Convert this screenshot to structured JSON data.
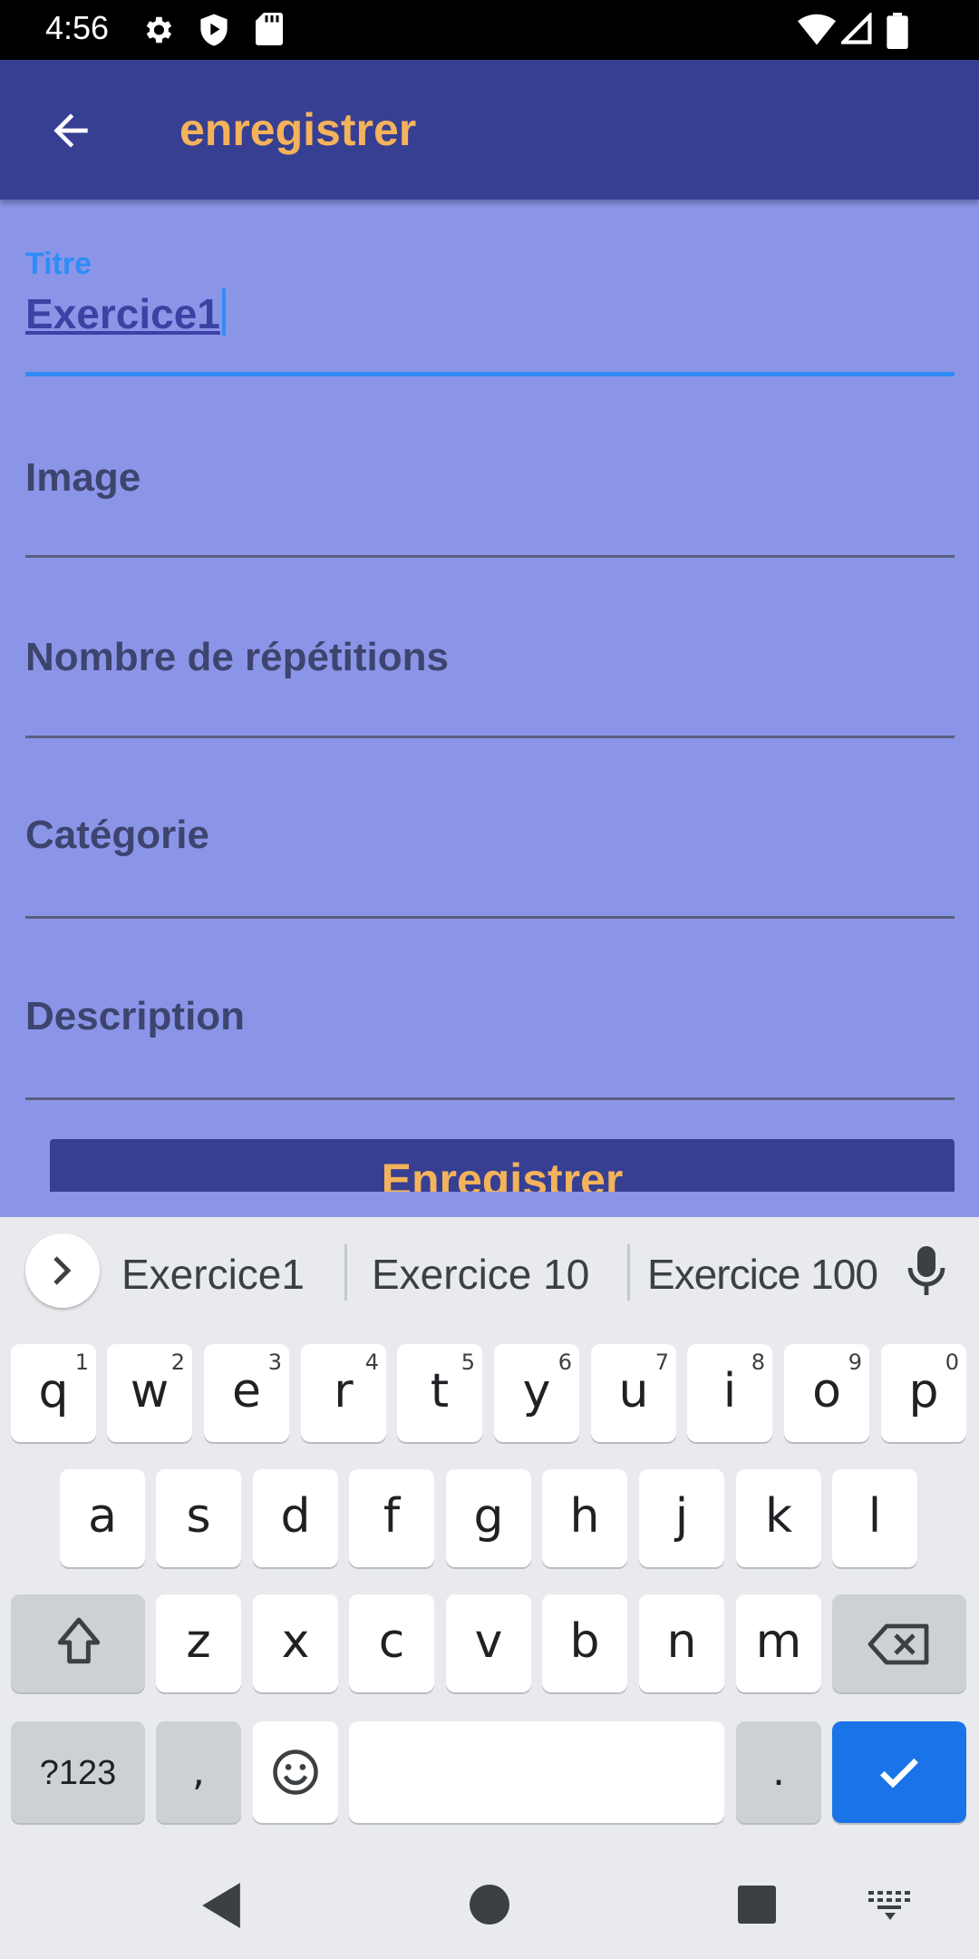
{
  "status_bar": {
    "time": "4:56",
    "left_icons": [
      "settings-icon",
      "play-protect-icon",
      "sd-card-icon"
    ],
    "right_icons": [
      "wifi-icon",
      "signal-icon",
      "battery-icon"
    ]
  },
  "app_bar": {
    "back_icon": "arrow-back-icon",
    "title": "enregistrer",
    "title_color": "#F4B35B",
    "background": "#373F93"
  },
  "form": {
    "title_field": {
      "label": "Titre",
      "value": "Exercice1"
    },
    "image_field": {
      "hint": "Image"
    },
    "repetitions_field": {
      "hint": "Nombre de répétitions"
    },
    "category_field": {
      "hint": "Catégorie"
    },
    "description_field": {
      "hint": "Description"
    },
    "save_button": {
      "label": "Enregistrer"
    },
    "accent_color": "#2F8CF6"
  },
  "keyboard": {
    "suggestions": [
      "Exercice1",
      "Exercice 10",
      "Exercice 100"
    ],
    "row1": [
      {
        "ch": "q",
        "num": "1"
      },
      {
        "ch": "w",
        "num": "2"
      },
      {
        "ch": "e",
        "num": "3"
      },
      {
        "ch": "r",
        "num": "4"
      },
      {
        "ch": "t",
        "num": "5"
      },
      {
        "ch": "y",
        "num": "6"
      },
      {
        "ch": "u",
        "num": "7"
      },
      {
        "ch": "i",
        "num": "8"
      },
      {
        "ch": "o",
        "num": "9"
      },
      {
        "ch": "p",
        "num": "0"
      }
    ],
    "row2": [
      "a",
      "s",
      "d",
      "f",
      "g",
      "h",
      "j",
      "k",
      "l"
    ],
    "row3": [
      "z",
      "x",
      "c",
      "v",
      "b",
      "n",
      "m"
    ],
    "symbols_key": "?123",
    "comma_key": ",",
    "period_key": ".",
    "enter_color": "#1A73E8"
  },
  "nav_bar": {
    "icons": [
      "back-triangle-icon",
      "home-circle-icon",
      "recents-square-icon",
      "keyboard-switch-icon"
    ]
  }
}
